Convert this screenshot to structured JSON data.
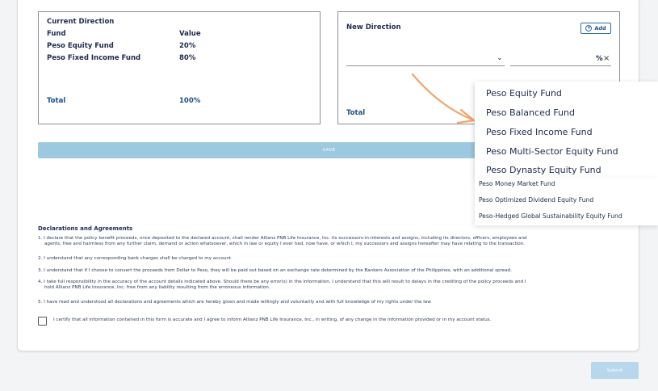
{
  "current_direction": {
    "title": "Current Direction",
    "header_fund": "Fund",
    "header_value": "Value",
    "rows": [
      {
        "fund": "Peso Equity Fund",
        "value": "20%"
      },
      {
        "fund": "Peso Fixed Income Fund",
        "value": "80%"
      }
    ],
    "total_label": "Total",
    "total_value": "100%"
  },
  "new_direction": {
    "title": "New Direction",
    "add_label": "Add",
    "percent_sign": "%",
    "total_label": "Total"
  },
  "save_label": "SAVE",
  "dropdown_large": [
    "Peso Equity Fund",
    "Peso Balanced Fund",
    "Peso Fixed Income Fund",
    "Peso Multi-Sector Equity Fund",
    "Peso Dynasty Equity Fund"
  ],
  "dropdown_small": [
    "Peso Money Market Fund",
    "Peso Optimized Dividend Equity Fund",
    "Peso-Hedged Global Sustainability Equity Fund"
  ],
  "declarations": {
    "title": "Declarations and Agreements",
    "items": [
      {
        "line1": "1. I declare that the policy benefit proceeds, once deposited to the declared account, shall render Allianz PNB Life Insurance, Inc. its successors-in-interests and assigns, including its directors, officers, employees and",
        "line2": "agents, free and harmless from any further claim, demand or action whatsoever, which in law or equity I ever had, now have, or which I, my successors and assigns hereafter may have relating to the transaction."
      },
      {
        "line1": "2. I understand that any corresponding bank charges shall be charged to my account.",
        "line2": ""
      },
      {
        "line1": "3. I understand that if I choose to convert the proceeds from Dollar to Peso, they will be paid out based on an exchange rate determined by the Bankers Association of the Philippines, with an additional spread.",
        "line2": ""
      },
      {
        "line1": "4. I take full responsibility in the accuracy of the account details indicated above. Should there be any error(s) in the information, I understand that this will result to delays in the crediting of the policy proceeds and I",
        "line2": "hold Allianz PNB Life Insurance, Inc. free from any liability resulting from the erroneous information."
      },
      {
        "line1": "5. I have read and understood all declarations and agreements which are hereby given and made willingly and voluntarily and with full knowledge of my rights under the law",
        "line2": ""
      }
    ],
    "certify": "I certify that all information contained in this form is accurate and I agree to inform Allianz PNB Life Insurance, Inc., in writing, of any change in the information provided or in my account status."
  },
  "submit_label": "Submit",
  "colors": {
    "primary": "#1e4f86",
    "save_button": "#9cc8e0",
    "submit_button": "#b8d7ec",
    "arrow": "#f4a46a"
  }
}
